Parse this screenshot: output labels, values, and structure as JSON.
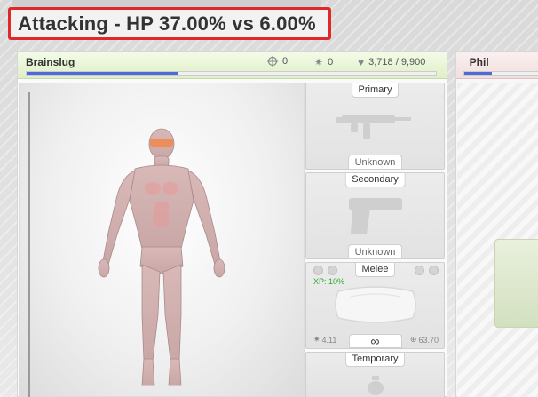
{
  "title": "Attacking - HP 37.00% vs 6.00%",
  "player": {
    "name": "Brainslug",
    "crosshair_value": "0",
    "burst_value": "0",
    "hp_text": "3,718 / 9,900",
    "hp_fraction": 0.37
  },
  "weapons": {
    "primary": {
      "label": "Primary",
      "status": "Unknown",
      "icon": "smg-icon"
    },
    "secondary": {
      "label": "Secondary",
      "status": "Unknown",
      "icon": "pistol-icon"
    },
    "melee": {
      "label": "Melee",
      "xp": "XP: 10%",
      "damage": "4.11",
      "accuracy": "63.70",
      "ammo": "∞",
      "icon": "pillow-icon"
    },
    "temporary": {
      "label": "Temporary",
      "icon": "grenade-icon"
    }
  },
  "opponent": {
    "name": "_Phil_",
    "hp_fraction": 0.06
  },
  "colors": {
    "highlight": "#e0282a",
    "hp_bar": "#4d6bd6",
    "xp_text": "#2aa82a"
  }
}
